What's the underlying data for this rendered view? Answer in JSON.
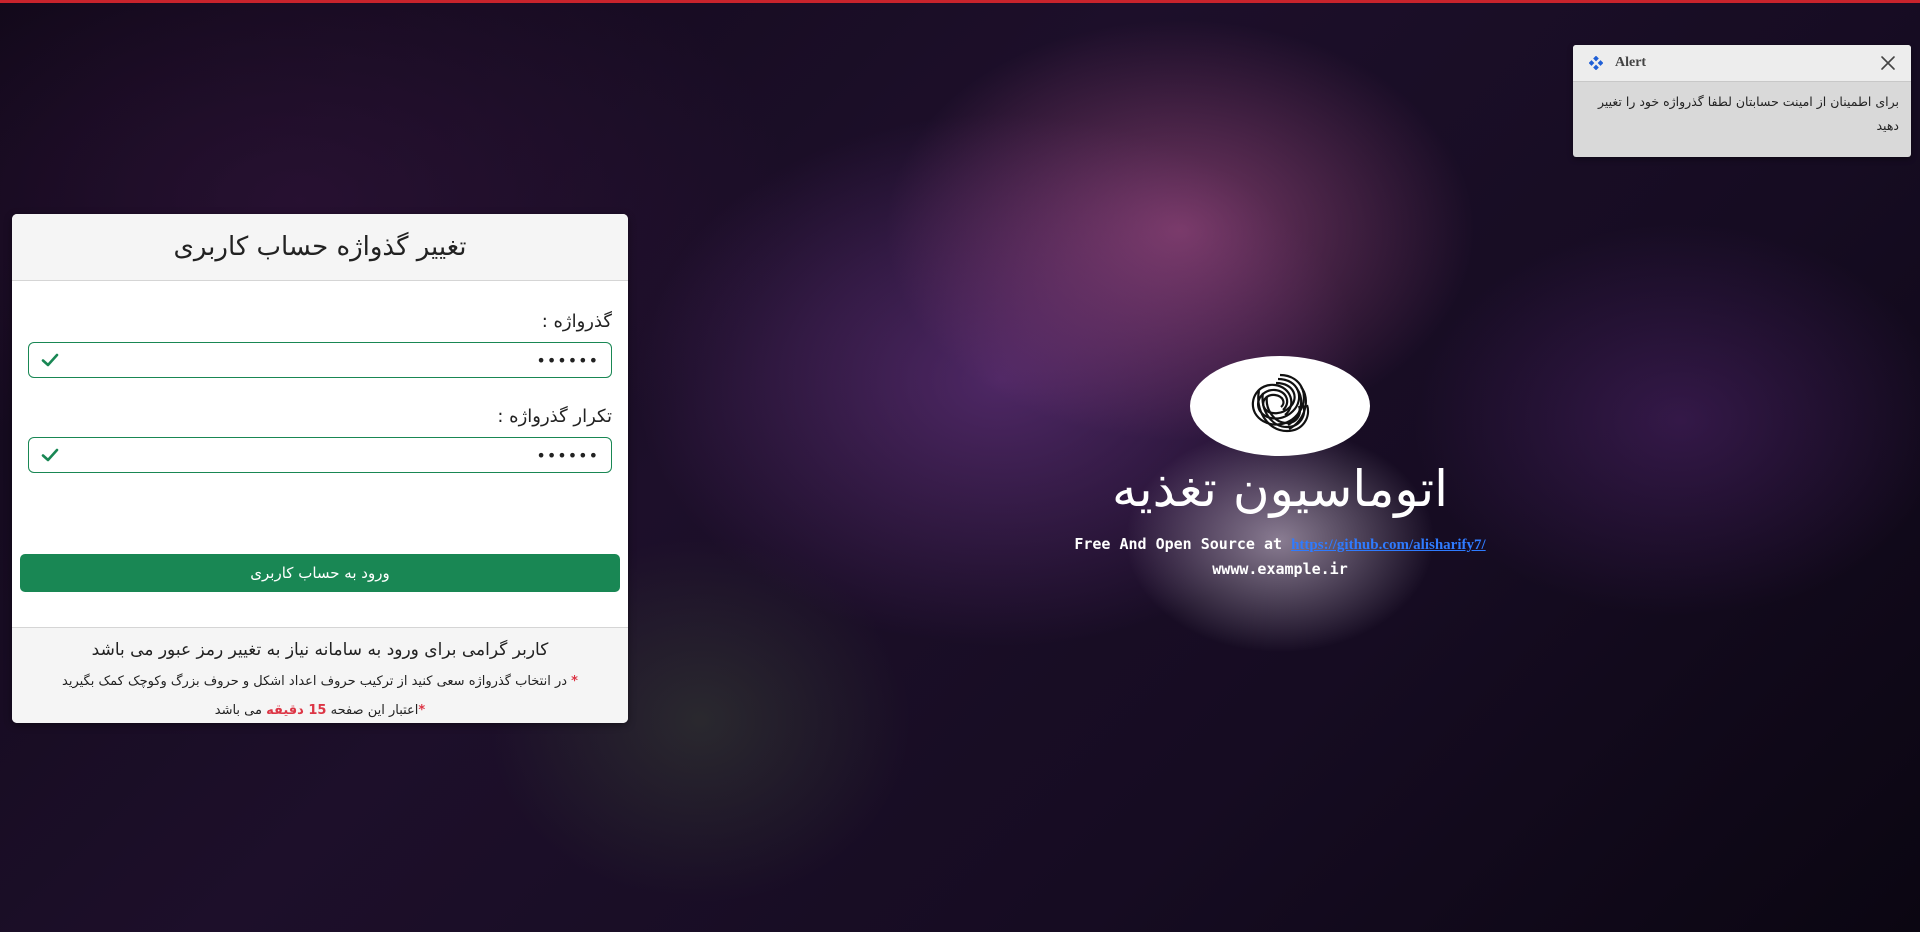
{
  "card": {
    "title": "تغییر گذواژه حساب کاربری",
    "password_label": "گذرواژه :",
    "password_value": "••••••",
    "repeat_label": "تکرار گذرواژه :",
    "repeat_value": "••••••",
    "submit_label": "ورود به حساب کاربری",
    "notice_main": "کاربر گرامی برای ورود به سامانه نیاز به تغییر رمز عبور می باشد",
    "notice_tip_star": "*",
    "notice_tip": " در انتخاب گذرواژه سعی کنید از ترکیب حروف اعداد اشکل و حروف بزرگ وکوچک کمک بگیرید",
    "notice_expiry_star": "*",
    "notice_expiry_prefix": "اعتبار این صفحه ",
    "notice_expiry_highlight": "15 دقیقه",
    "notice_expiry_suffix": " می باشد"
  },
  "brand": {
    "title": "اتوماسیون تغذیه",
    "oss_prefix": "Free And Open Source at ",
    "oss_link": "https://github.com/alisharify7/",
    "site": "wwww.example.ir",
    "logo_icon": "woolmark-icon"
  },
  "alert": {
    "title": "Alert",
    "message": "برای اطمینان از امینت حسابتان لطفا گذرواژه خود را تغییر دهید",
    "icon": "diamond-icon",
    "close_icon": "close-icon"
  },
  "colors": {
    "accent": "#198754",
    "danger": "#dc3545",
    "top_bar": "#c8232c",
    "link": "#2f7bff"
  }
}
